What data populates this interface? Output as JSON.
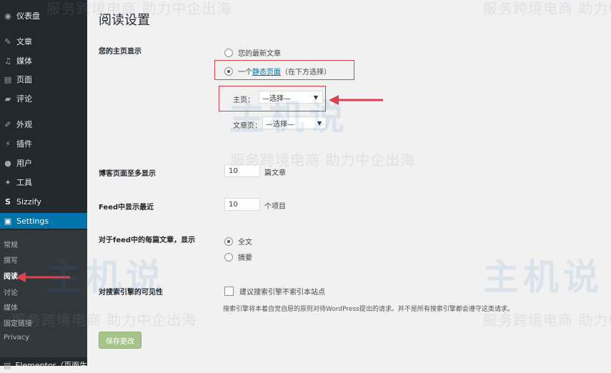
{
  "sidebar": {
    "items": [
      {
        "label": "仪表盘",
        "icon": "dashboard-icon"
      },
      {
        "label": "文章",
        "icon": "pin-icon"
      },
      {
        "label": "媒体",
        "icon": "media-icon"
      },
      {
        "label": "页面",
        "icon": "page-icon"
      },
      {
        "label": "评论",
        "icon": "comment-icon"
      },
      {
        "label": "外观",
        "icon": "brush-icon"
      },
      {
        "label": "插件",
        "icon": "plugin-icon"
      },
      {
        "label": "用户",
        "icon": "user-icon"
      },
      {
        "label": "工具",
        "icon": "wrench-icon"
      },
      {
        "label": "Sizzify",
        "icon": "sizzify-icon"
      },
      {
        "label": "Settings",
        "icon": "settings-icon"
      }
    ],
    "submenu": [
      "常规",
      "撰写",
      "阅读",
      "讨论",
      "媒体",
      "固定链接",
      "Privacy"
    ],
    "bottom_item": "Elementor（页面生"
  },
  "page": {
    "title": "阅读设置",
    "homepage_label": "您的主页显示",
    "opt_latest": "您的最新文章",
    "opt_static_prefix": "一个",
    "opt_static_link": "静态页面",
    "opt_static_suffix": "（在下方选择）",
    "home_label": "主页：",
    "home_select": "—选择—",
    "posts_label": "文章页：",
    "posts_select": "—选择—",
    "blog_pages_label": "博客页面至多显示",
    "blog_pages_value": "10",
    "blog_pages_suffix": "篇文章",
    "feed_label": "Feed中显示最近",
    "feed_value": "10",
    "feed_suffix": "个项目",
    "feed_each_label": "对于feed中的每篇文章，显示",
    "opt_full": "全文",
    "opt_summary": "摘要",
    "seo_label": "对搜索引擎的可见性",
    "seo_checkbox": "建议搜索引擎不索引本站点",
    "seo_desc": "搜索引擎将本着自觉自愿的原则对待WordPress提出的请求。并不是所有搜索引擎都会遵守这类请求。",
    "save_button": "保存更改"
  },
  "watermark": {
    "slogan": "服务跨境电商 助力中企出海",
    "brand": "主机说"
  }
}
